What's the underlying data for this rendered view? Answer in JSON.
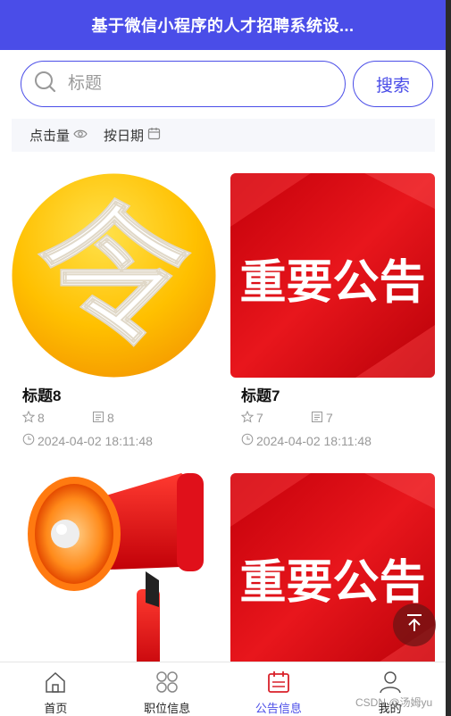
{
  "header": {
    "title": "基于微信小程序的人才招聘系统设..."
  },
  "search": {
    "placeholder": "标题",
    "button_label": "搜索"
  },
  "sort": {
    "items": [
      {
        "label": "点击量",
        "icon": "eye-icon"
      },
      {
        "label": "按日期",
        "icon": "calendar-icon"
      }
    ]
  },
  "cards": [
    {
      "title": "标题8",
      "likes": "8",
      "views": "8",
      "date": "2024-04-02 18:11:48",
      "image": "ling-character-logo"
    },
    {
      "title": "标题7",
      "likes": "7",
      "views": "7",
      "date": "2024-04-02 18:11:48",
      "image": "important-notice-banner",
      "image_text": "重要公告"
    },
    {
      "image": "red-megaphone"
    },
    {
      "image": "important-notice-banner",
      "image_text": "重要公告"
    }
  ],
  "logo_text": "令",
  "tabbar": [
    {
      "label": "首页",
      "icon": "home-icon",
      "active": false
    },
    {
      "label": "职位信息",
      "icon": "grid-icon",
      "active": false
    },
    {
      "label": "公告信息",
      "icon": "notice-icon",
      "active": true
    },
    {
      "label": "我的",
      "icon": "user-icon",
      "active": false
    }
  ],
  "watermark": "CSDN @汤姆yu",
  "colors": {
    "primary": "#4a4de8",
    "banner_red": "#e10a10",
    "gold": "#f7b900"
  }
}
